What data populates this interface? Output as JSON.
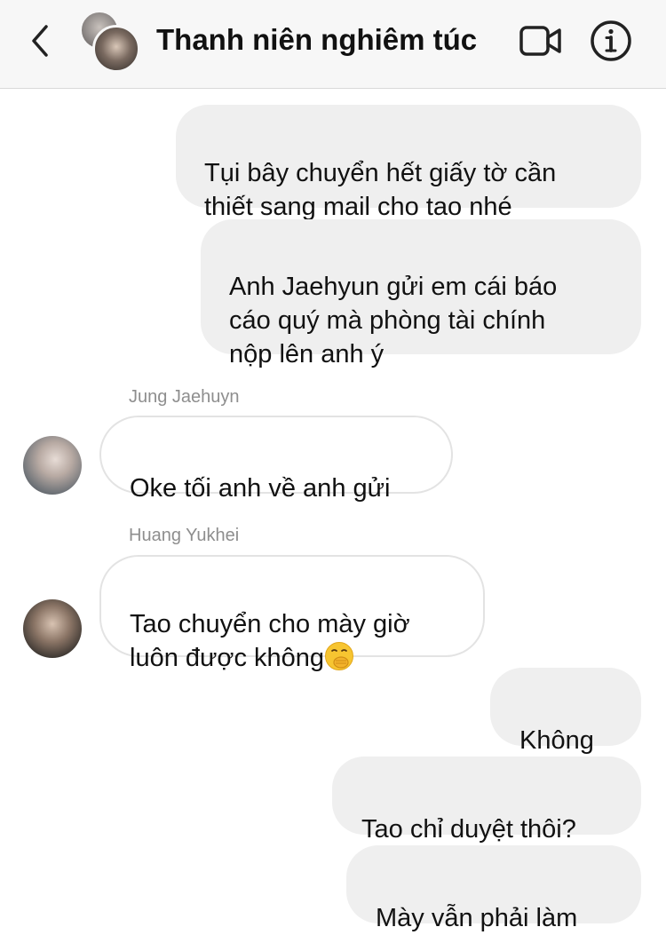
{
  "header": {
    "title": "Thanh niên nghiêm túc",
    "back_icon": "chevron-left-icon",
    "video_icon": "video-camera-icon",
    "info_icon": "info-icon"
  },
  "messages": [
    {
      "direction": "outgoing",
      "text": "Tụi bây chuyển hết giấy tờ cần\nthiết sang mail cho tao nhé"
    },
    {
      "direction": "outgoing",
      "text": "Anh Jaehyun gửi em cái báo\ncáo quý mà phòng tài chính\nnộp lên anh ý"
    },
    {
      "direction": "incoming",
      "sender": "Jung Jaehuyn",
      "text": "Oke tối anh về anh gửi"
    },
    {
      "direction": "incoming",
      "sender": "Huang Yukhei",
      "text": "Tao chuyển cho mày giờ\nluôn được không",
      "emoji": "face-with-hand-over-mouth-emoji"
    },
    {
      "direction": "outgoing",
      "text": "Không"
    },
    {
      "direction": "outgoing",
      "text": "Tao chỉ duyệt thôi?"
    },
    {
      "direction": "outgoing",
      "text": "Mày vẫn phải làm"
    }
  ],
  "colors": {
    "header_bg": "#f7f7f7",
    "outgoing_bubble": "#efefef",
    "incoming_border": "#e3e3e3",
    "sender_name": "#8e8e8e"
  }
}
